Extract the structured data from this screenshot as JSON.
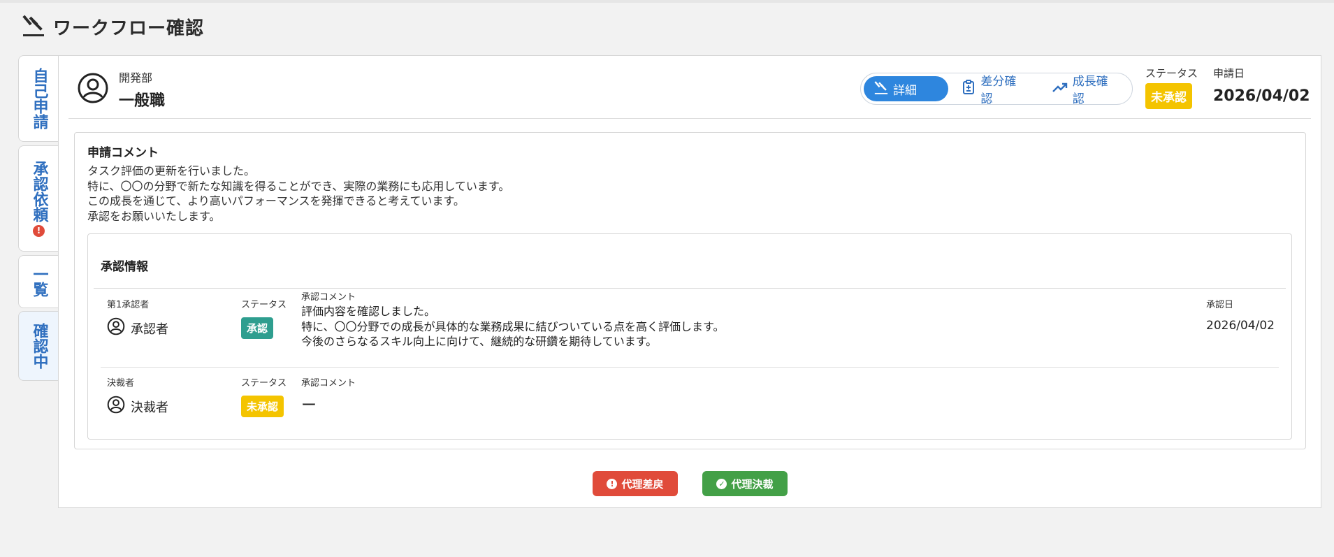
{
  "page": {
    "title": "ワークフロー確認"
  },
  "tabs": [
    {
      "label": "自己申請",
      "active": false,
      "alert": false
    },
    {
      "label": "承認依頼",
      "active": false,
      "alert": true
    },
    {
      "label": "一覧",
      "active": false,
      "alert": false
    },
    {
      "label": "確認中",
      "active": true,
      "alert": false
    }
  ],
  "user": {
    "department": "開発部",
    "role": "一般職"
  },
  "segment": {
    "detail": "詳細",
    "diff": "差分確認",
    "growth": "成長確認"
  },
  "meta": {
    "status_label": "ステータス",
    "status_value": "未承認",
    "date_label": "申請日",
    "date_value": "2026/04/02"
  },
  "application": {
    "heading": "申請コメント",
    "body": "タスク評価の更新を行いました。\n特に、〇〇の分野で新たな知識を得ることができ、実際の業務にも応用しています。\nこの成長を通じて、より高いパフォーマンスを発揮できると考えています。\n承認をお願いいたします。"
  },
  "approval": {
    "heading": "承認情報",
    "first": {
      "role_label": "第1承認者",
      "name": "承認者",
      "status_label": "ステータス",
      "status_value": "承認",
      "comment_label": "承認コメント",
      "comment": "評価内容を確認しました。\n特に、〇〇分野での成長が具体的な業務成果に結びついている点を高く評価します。\n今後のさらなるスキル向上に向けて、継続的な研鑽を期待しています。",
      "date_label": "承認日",
      "date_value": "2026/04/02"
    },
    "final": {
      "role_label": "決裁者",
      "name": "決裁者",
      "status_label": "ステータス",
      "status_value": "未承認",
      "comment_label": "承認コメント",
      "comment": "ー"
    }
  },
  "actions": {
    "reject": "代理差戻",
    "approve": "代理決裁"
  },
  "colors": {
    "accent": "#2e86de",
    "danger": "#e04b3a",
    "success": "#43a047",
    "warning": "#f4c400",
    "teal": "#2e9e8f"
  },
  "icons": {
    "header": "gavel-icon",
    "user": "user-circle-icon",
    "diff": "document-diff-icon",
    "growth": "trending-up-icon"
  }
}
